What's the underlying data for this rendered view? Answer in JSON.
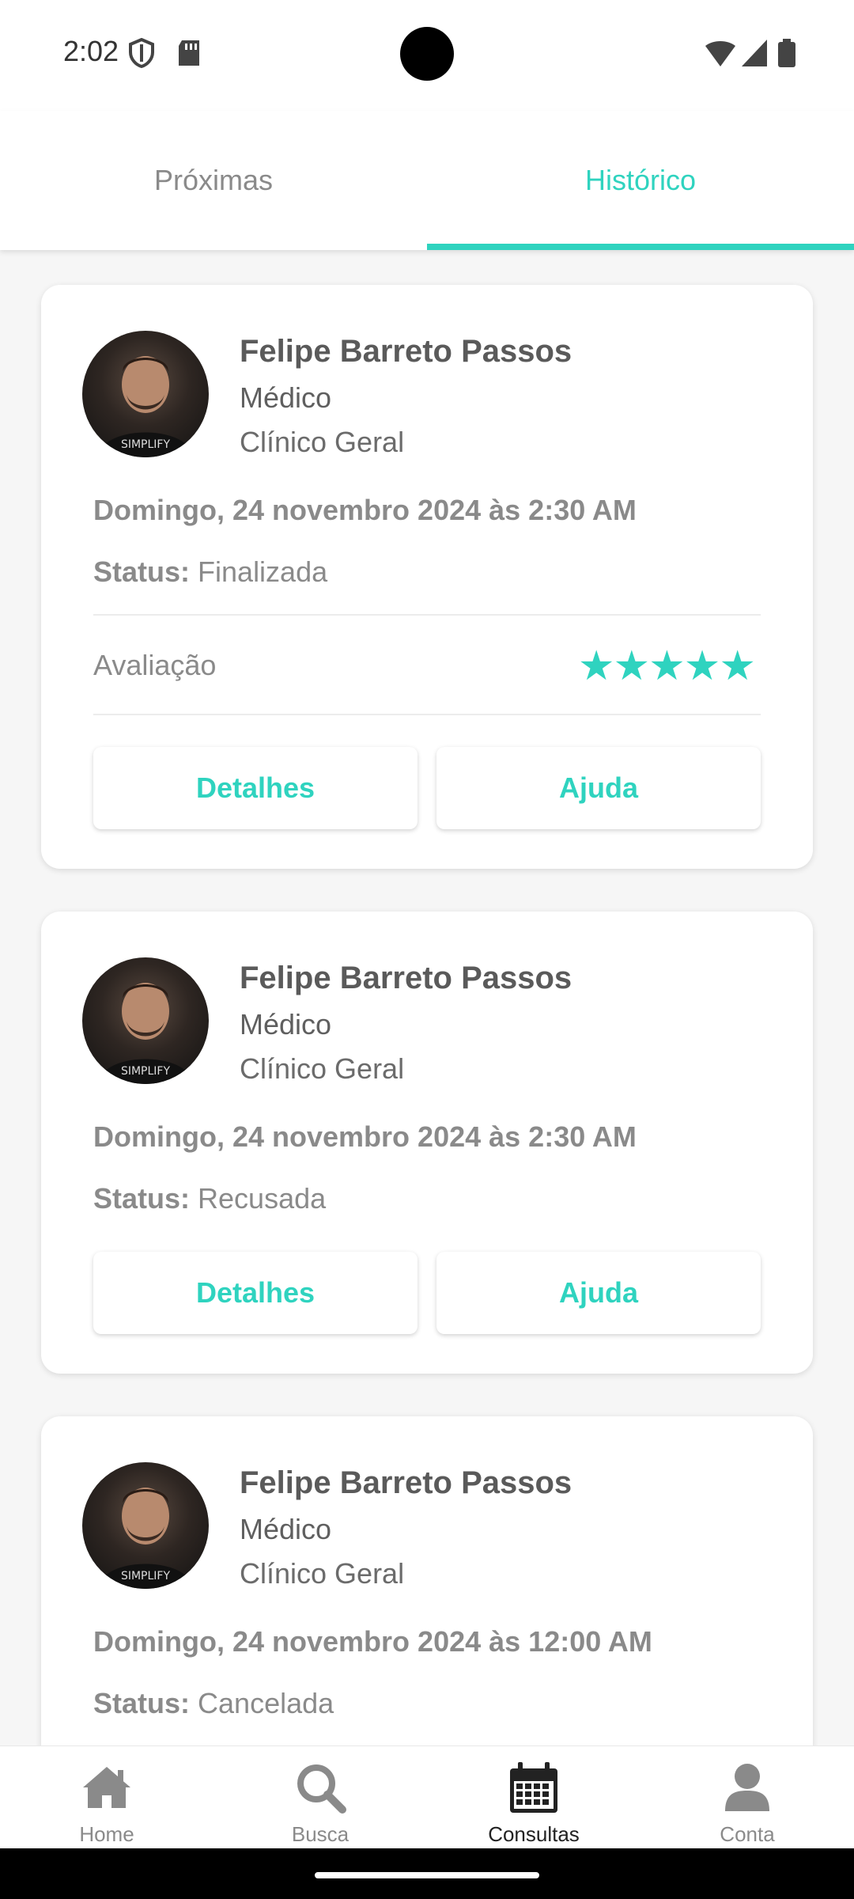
{
  "status_bar": {
    "time": "2:02"
  },
  "tabs": [
    {
      "label": "Próximas",
      "active": false
    },
    {
      "label": "Histórico",
      "active": true
    }
  ],
  "colors": {
    "accent": "#2fd3bf",
    "text": "#5a5a5a",
    "muted": "#8a8a8a",
    "background": "#f6f6f6"
  },
  "cards": [
    {
      "name": "Felipe Barreto Passos",
      "role": "Médico",
      "specialty": "Clínico Geral",
      "date": "Domingo, 24 novembro 2024 às 2:30 AM",
      "status_label": "Status:",
      "status_value": "Finalizada",
      "rating_label": "Avaliação",
      "rating": 5,
      "stars": "★★★★★",
      "buttons": {
        "details": "Detalhes",
        "help": "Ajuda"
      },
      "avatar_text": "SIMPLIFY"
    },
    {
      "name": "Felipe Barreto Passos",
      "role": "Médico",
      "specialty": "Clínico Geral",
      "date": "Domingo, 24 novembro 2024 às 2:30 AM",
      "status_label": "Status:",
      "status_value": "Recusada",
      "buttons": {
        "details": "Detalhes",
        "help": "Ajuda"
      },
      "avatar_text": "SIMPLIFY"
    },
    {
      "name": "Felipe Barreto Passos",
      "role": "Médico",
      "specialty": "Clínico Geral",
      "date": "Domingo, 24 novembro 2024 às 12:00 AM",
      "status_label": "Status:",
      "status_value": "Cancelada",
      "avatar_text": "SIMPLIFY"
    }
  ],
  "bottom_nav": [
    {
      "label": "Home",
      "icon": "home-icon",
      "active": false
    },
    {
      "label": "Busca",
      "icon": "search-icon",
      "active": false
    },
    {
      "label": "Consultas",
      "icon": "calendar-icon",
      "active": true
    },
    {
      "label": "Conta",
      "icon": "user-icon",
      "active": false
    }
  ]
}
